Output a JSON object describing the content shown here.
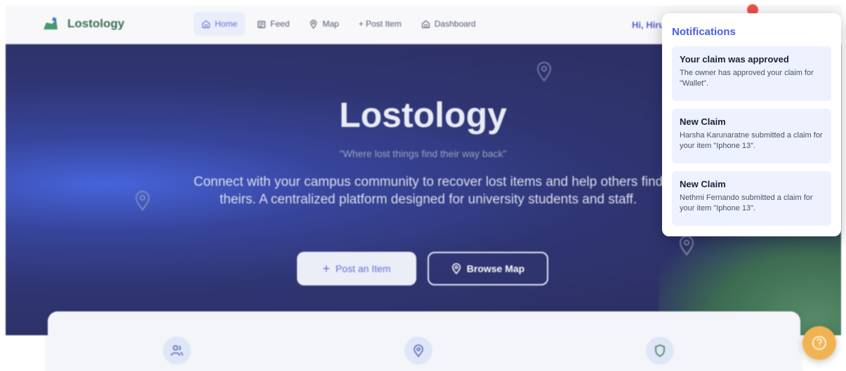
{
  "app": {
    "brand_name": "Lostology",
    "greeting": "Hi, Hiru"
  },
  "nav": {
    "items": [
      {
        "label": "Home",
        "icon": "home-icon",
        "active": true
      },
      {
        "label": "Feed",
        "icon": "feed-icon",
        "active": false
      },
      {
        "label": "Map",
        "icon": "map-pin-icon",
        "active": false
      },
      {
        "label": "+ Post Item",
        "icon": "",
        "active": false
      },
      {
        "label": "Dashboard",
        "icon": "home-icon",
        "active": false
      }
    ]
  },
  "hero": {
    "title": "Lostology",
    "tagline": "\"Where lost things find their way back\"",
    "description": "Connect with your campus community to recover lost items and help others find theirs. A centralized platform designed for university students and staff.",
    "post_button": "Post an Item",
    "map_button": "Browse Map"
  },
  "features": {
    "icons": [
      "users-icon",
      "map-pin-icon",
      "shield-icon"
    ]
  },
  "notifications": {
    "title": "Notifications",
    "items": [
      {
        "title": "Your claim was approved",
        "body": "The owner has approved your claim for \"Wallet\"."
      },
      {
        "title": "New Claim",
        "body": "Harsha Karunaratne submitted a claim for your item \"Iphone 13\"."
      },
      {
        "title": "New Claim",
        "body": "Nethmi Fernando submitted a claim for your item \"Iphone 13\"."
      }
    ]
  },
  "colors": {
    "accent": "#4f5bd5",
    "brand_green": "#1e5a3a",
    "hero_bg": "#101451",
    "notif_item_bg": "#edf2fe",
    "help_button": "#f0a93a",
    "badge": "#e53935"
  }
}
